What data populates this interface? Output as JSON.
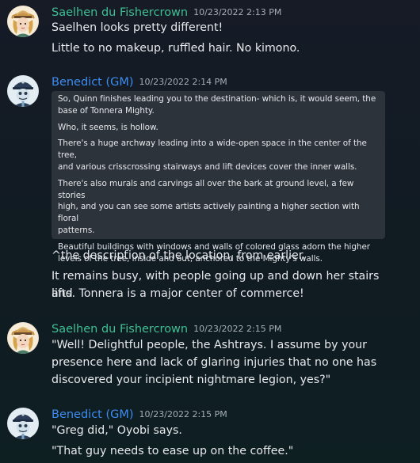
{
  "messages": [
    {
      "author": "Saelhen du Fishercrown",
      "timestamp": "10/23/2022 2:13 PM",
      "lines": [
        "Saelhen looks pretty different!",
        "Little to no makeup, ruffled hair. No kimono."
      ]
    },
    {
      "author": "Benedict (GM)",
      "timestamp": "10/23/2022 2:14 PM",
      "quote": [
        [
          "So, Quinn finishes leading you to the destination- which is, it would seem, the",
          "base of Tonnera Mighty."
        ],
        [
          "Who, it seems, is hollow."
        ],
        [
          "There's a huge archway leading into a wide-open space in the center of the tree,",
          "and various crisscrossing stairways and lift devices cover the inner walls."
        ],
        [
          "There's also murals and carvings all over the bark at ground level, a few stories",
          "high, and you can see some artists actively painting a higher section with floral",
          "patterns."
        ],
        [
          "Beautiful buildings with windows and walls of colored glass adorn the higher",
          "levels of the tree, inside and out, anchored to the Mighty's walls."
        ]
      ],
      "lines": [
        "^the description of the location, from earlier.",
        "It remains busy, with people going up and down her stairs and",
        "lifts. Tonnera is a major center of commerce!"
      ]
    },
    {
      "author": "Saelhen du Fishercrown",
      "timestamp": "10/23/2022 2:15 PM",
      "lines": [
        "\"Well! Delightful people, the Ashtrays. I assume by your",
        "presence here and lack of glaring injuries that no one has",
        "discovered your incipient nightmare legion, yes?\""
      ]
    },
    {
      "author": "Benedict (GM)",
      "timestamp": "10/23/2022 2:15 PM",
      "lines": [
        "\"Greg did,\" Oyobi says.",
        "\"That guy needs to ease up on the coffee.\""
      ]
    }
  ],
  "colors": {
    "saelhen_name": "#3fbf94",
    "gm_name": "#3d8cf0",
    "quote_bg": "#2d333b"
  },
  "icons": {
    "saelhen_avatar": "saelhen-avatar-icon",
    "benedict_avatar": "benedict-avatar-icon"
  }
}
